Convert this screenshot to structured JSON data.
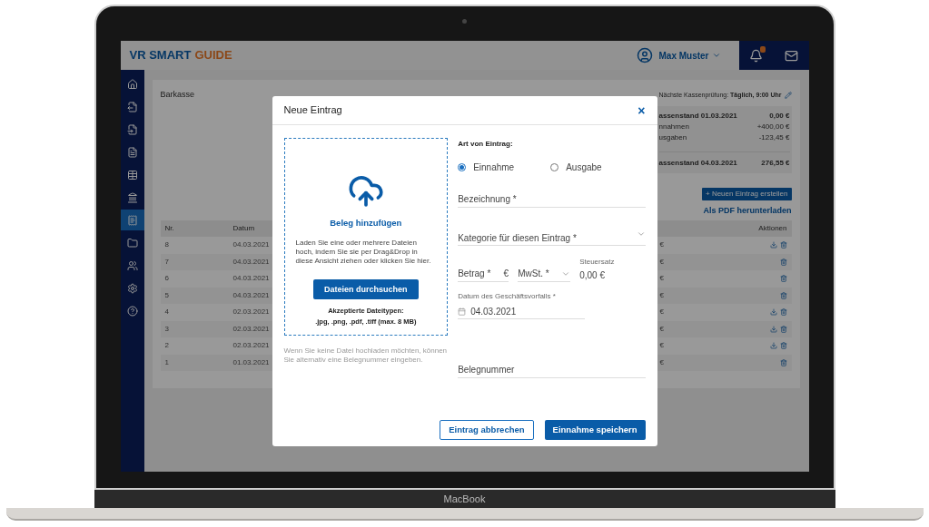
{
  "device": {
    "label": "MacBook"
  },
  "header": {
    "logo_primary": "VR SMART",
    "logo_accent": "GUIDE",
    "user": "Max Muster",
    "notifications_unread": true
  },
  "sidebar": {
    "items": [
      {
        "kind": "home",
        "selected": false
      },
      {
        "kind": "file-out",
        "selected": false
      },
      {
        "kind": "file-in",
        "selected": false
      },
      {
        "kind": "file",
        "selected": false
      },
      {
        "kind": "table",
        "selected": false
      },
      {
        "kind": "bank",
        "selected": false
      },
      {
        "kind": "receipt",
        "selected": true
      },
      {
        "kind": "folder",
        "selected": false
      },
      {
        "kind": "users",
        "selected": false
      },
      {
        "kind": "settings",
        "selected": false
      },
      {
        "kind": "help",
        "selected": false
      }
    ]
  },
  "page": {
    "title": "Barkasse",
    "next_check": "Nächste Kassenprüfung: **Täglich, 9:00 Uhr**",
    "summary": [
      {
        "kind": "balance",
        "label": "assenstand 01.03.2021",
        "value": "0,00 €"
      },
      {
        "kind": "movement",
        "label": "nnahmen",
        "value": "+400,00 €"
      },
      {
        "kind": "movement",
        "label": "usgaben",
        "value": "-123,45 €"
      },
      {
        "kind": "balance",
        "label": "assenstand 04.03.2021",
        "value": "276,55 €"
      }
    ],
    "create_button": "+ Neuen Eintrag erstellen",
    "pdf_link": "Als PDF herunterladen",
    "table": {
      "columns": [
        "Nr.",
        "Datum",
        "Aktionen"
      ],
      "rows": [
        {
          "nr": "8",
          "date": "04.03.2021",
          "amount": "€",
          "download": true
        },
        {
          "nr": "7",
          "date": "04.03.2021",
          "amount": "€",
          "download": false
        },
        {
          "nr": "6",
          "date": "04.03.2021",
          "amount": "€",
          "download": false
        },
        {
          "nr": "5",
          "date": "04.03.2021",
          "amount": "€",
          "download": false
        },
        {
          "nr": "4",
          "date": "02.03.2021",
          "amount": "€",
          "download": true
        },
        {
          "nr": "3",
          "date": "02.03.2021",
          "amount": "€",
          "download": true
        },
        {
          "nr": "2",
          "date": "02.03.2021",
          "amount": "€",
          "download": true
        },
        {
          "nr": "1",
          "date": "01.03.2021",
          "amount": "€",
          "download": false
        }
      ]
    }
  },
  "dialog": {
    "title": "Neue Eintrag",
    "close": "×",
    "upload": {
      "title": "Beleg hinzufügen",
      "text": "Laden Sie eine oder mehrere Dateien hoch, indem Sie sie per Drag&Drop in diese Ansicht ziehen oder klicken Sie hier.",
      "button": "Dateien durchsuchen",
      "types_label": "Akzeptierte Dateitypen:",
      "types": ".jpg, .png, .pdf, .tiff (max. 8 MB)"
    },
    "hint": "Wenn Sie keine Datei hochladen möchten, können Sie alternativ eine Belegnummer eingeben.",
    "type_label": "Art von Eintrag:",
    "types": [
      {
        "label": "Einnahme",
        "selected": true
      },
      {
        "label": "Ausgabe",
        "selected": false
      }
    ],
    "name_placeholder": "Bezeichnung *",
    "category_placeholder": "Kategorie für diesen Eintrag *",
    "amount_placeholder": "Betrag *",
    "currency": "€",
    "vat_placeholder": "MwSt. *",
    "tax_label": "Steuersatz",
    "tax_value": "0,00 €",
    "date_label": "Datum des Geschäftsvorfalls *",
    "date_value": "04.03.2021",
    "receipt_placeholder": "Belegnummer",
    "cancel": "Eintrag abbrechen",
    "save": "Einnahme speichern"
  }
}
